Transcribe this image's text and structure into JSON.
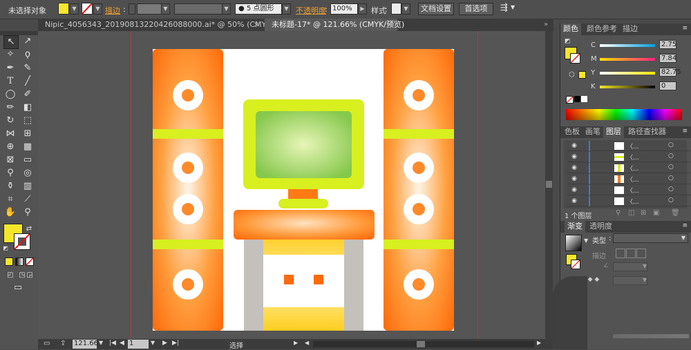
{
  "control_bar": {
    "selection_status": "未选择对象",
    "stroke_label": "描边",
    "brush_label": "5 点圆形",
    "opacity_label": "不透明度",
    "opacity_value": "100%",
    "style_label": "样式",
    "doc_setup_button": "文档设置",
    "preferences_button": "首选项",
    "fill_color": "#f5e62a"
  },
  "tabs": [
    {
      "label": "Nipic_4056343_20190813220426088000.ai* @ 50% (CMYK/预览)",
      "active": false
    },
    {
      "label": "未标题-17* @ 121.66% (CMYK/预览)",
      "active": true
    }
  ],
  "status_bar": {
    "zoom": "121.66",
    "page": "1",
    "tool": "选择"
  },
  "color_panel": {
    "tabs": [
      "颜色",
      "颜色参考",
      "描边"
    ],
    "sliders": [
      {
        "label": "C",
        "value": "2.75"
      },
      {
        "label": "M",
        "value": "7.84"
      },
      {
        "label": "Y",
        "value": "82.75"
      },
      {
        "label": "K",
        "value": "0"
      }
    ]
  },
  "layers_panel": {
    "tabs": [
      "色板",
      "画笔",
      "图层",
      "路径查找器"
    ],
    "row_label": "〈...",
    "count": "1 个图层"
  },
  "gradient_panel": {
    "tabs": [
      "渐变",
      "透明度"
    ],
    "type_label": "类型",
    "stroke_label": "描边"
  },
  "colors": {
    "orange": "#ff7a14",
    "yellow_green": "#d8ef20",
    "screen_green": "#9cd45a",
    "fill": "#f5e62a"
  }
}
